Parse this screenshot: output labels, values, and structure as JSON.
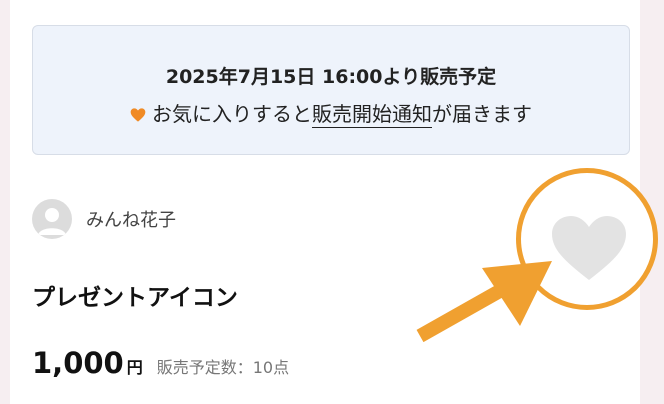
{
  "notice": {
    "line1": "2025年7月15日 16:00より販売予定",
    "line2_prefix": "お気に入りすると",
    "line2_link": "販売開始通知",
    "line2_suffix": "が届きます"
  },
  "seller": {
    "name": "みんね花子"
  },
  "product": {
    "title": "プレゼントアイコン",
    "price": "1,000",
    "currency": "円",
    "stock_label": "販売予定数：10点"
  },
  "colors": {
    "accent_orange": "#f0a030",
    "heart_gray": "#e3e3e3",
    "small_heart": "#f08a24"
  },
  "icons": {
    "favorite": "heart-icon",
    "notice_heart": "heart-icon",
    "avatar": "user-icon",
    "annotation_arrow": "arrow-icon"
  }
}
